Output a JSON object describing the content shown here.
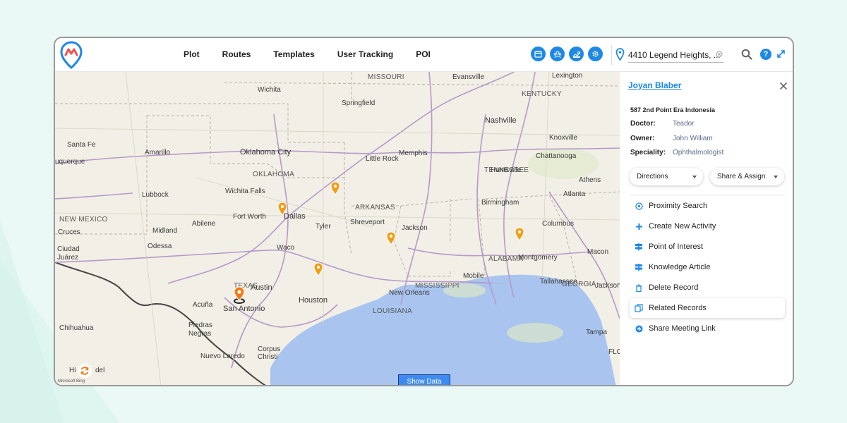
{
  "nav": {
    "items": [
      "Plot",
      "Routes",
      "Templates",
      "User Tracking",
      "POI"
    ]
  },
  "toolbar": {
    "icons": [
      "calendar-icon",
      "team-icon",
      "territory-icon",
      "settings-icon"
    ],
    "accent_color": "#1e88e5"
  },
  "location": {
    "value": "4410 Legend Heights, ..."
  },
  "help": {
    "label": "?"
  },
  "map": {
    "states": [
      "MISSOURI",
      "KENTUCKY",
      "OKLAHOMA",
      "TENNESSEE",
      "ARKANSAS",
      "NEW MEXICO",
      "TEXAS",
      "MISSISSIPPI",
      "ALABAMA",
      "GEORGIA",
      "LOUISIANA"
    ],
    "cities": [
      "Evansville",
      "Lexington",
      "Wichita",
      "Springfield",
      "Nashville",
      "Knoxville",
      "Santa Fe",
      "uquerque",
      "Amarillo",
      "Oklahoma City",
      "Memphis",
      "Little Rock",
      "Chattanooga",
      "Huntsville",
      "Athens",
      "Lubbock",
      "Wichita Falls",
      "Atlanta",
      "Fort Worth",
      "Dallas",
      "Birmingham",
      "Abilene",
      "Tyler",
      "Shreveport",
      "Jackson",
      "Columbus",
      "Cruces",
      "Midland",
      "Ciudad Juárez",
      "Odessa",
      "Waco",
      "Montgomery",
      "Macon",
      "Austin",
      "Mobile",
      "Tallahassee",
      "Jackson",
      "San Antonio",
      "Houston",
      "New Orleans",
      "Acuña",
      "Chihuahua",
      "Piedras Negras",
      "Tampa",
      "Corpus Christi",
      "Nuevo Laredo",
      "FLO",
      "Hi",
      "del"
    ],
    "show_data_label": "Show Data",
    "attribution": "Microsoft Bing",
    "marker_color": "#f39c12"
  },
  "panel": {
    "name": "Joyan Blaber",
    "address": "587 2nd Point Era Indonesia",
    "fields": [
      {
        "key": "Doctor:",
        "value": "Teador"
      },
      {
        "key": "Owner:",
        "value": "John William"
      },
      {
        "key": "Speciality:",
        "value": "Ophthalmologist"
      }
    ],
    "directions_label": "Directions",
    "share_label": "Share & Assign",
    "actions": [
      {
        "label": "Proximity Search",
        "icon": "proximity-icon"
      },
      {
        "label": "Create New Activity",
        "icon": "plus-icon"
      },
      {
        "label": "Point of Interest",
        "icon": "signpost-icon"
      },
      {
        "label": "Knowledge Article",
        "icon": "signpost-icon"
      },
      {
        "label": "Delete Record",
        "icon": "trash-icon"
      },
      {
        "label": "Related Records",
        "icon": "copy-icon"
      },
      {
        "label": "Share Meeting Link",
        "icon": "share-icon"
      }
    ]
  }
}
